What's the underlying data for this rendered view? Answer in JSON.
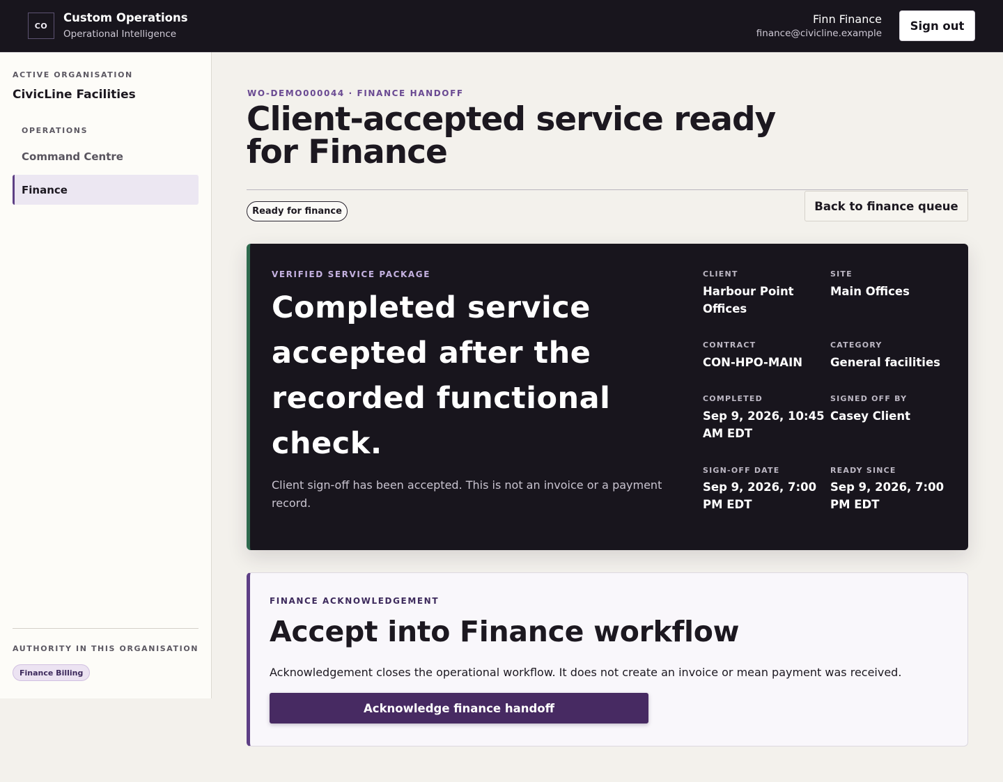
{
  "header": {
    "logo_text": "CO",
    "app_name": "Custom Operations",
    "app_subtitle": "Operational Intelligence",
    "user_name": "Finn Finance",
    "user_email": "finance@civicline.example",
    "signout_label": "Sign out"
  },
  "sidebar": {
    "org_label": "ACTIVE ORGANISATION",
    "org_name": "CivicLine Facilities",
    "section_label": "OPERATIONS",
    "items": [
      {
        "label": "Command Centre",
        "active": false
      },
      {
        "label": "Finance",
        "active": true
      }
    ],
    "authority_label": "AUTHORITY IN THIS ORGANISATION",
    "roles": [
      "Finance Billing"
    ]
  },
  "main": {
    "eyebrow": "WO-DEMO000044 · FINANCE HANDOFF",
    "title": "Client-accepted service ready for Finance",
    "status": "Ready for finance",
    "back_label": "Back to finance queue"
  },
  "package": {
    "eyebrow": "VERIFIED SERVICE PACKAGE",
    "headline": "Completed service accepted after the recorded functional check.",
    "note": "Client sign-off has been accepted. This is not an invoice or a payment record.",
    "facts": [
      {
        "label": "CLIENT",
        "value": "Harbour Point Offices"
      },
      {
        "label": "SITE",
        "value": "Main Offices"
      },
      {
        "label": "CONTRACT",
        "value": "CON-HPO-MAIN"
      },
      {
        "label": "CATEGORY",
        "value": "General facilities"
      },
      {
        "label": "COMPLETED",
        "value": "Sep 9, 2026, 10:45 AM EDT"
      },
      {
        "label": "SIGNED OFF BY",
        "value": "Casey Client"
      },
      {
        "label": "SIGN-OFF DATE",
        "value": "Sep 9, 2026, 7:00 PM EDT"
      },
      {
        "label": "READY SINCE",
        "value": "Sep 9, 2026, 7:00 PM EDT"
      }
    ]
  },
  "ack": {
    "eyebrow": "FINANCE ACKNOWLEDGEMENT",
    "title": "Accept into Finance workflow",
    "description": "Acknowledgement closes the operational workflow. It does not create an invoice or mean payment was received.",
    "button_label": "Acknowledge finance handoff"
  },
  "colors": {
    "topbar": "#18151d",
    "accent": "#5d3f85",
    "card_stripe": "#2e6a4e",
    "page_bg": "#f3f1ec"
  }
}
